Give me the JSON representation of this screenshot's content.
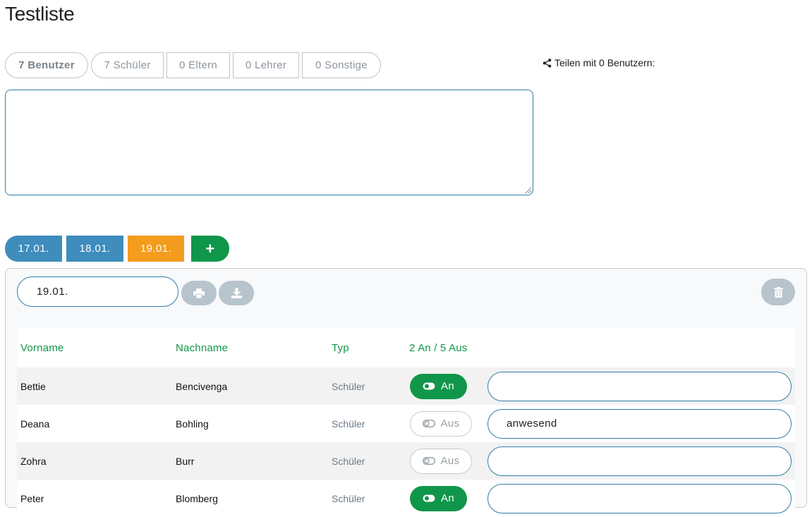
{
  "page": {
    "title": "Testliste"
  },
  "filters": [
    {
      "label": "7 Benutzer"
    },
    {
      "label": "7 Schüler"
    },
    {
      "label": "0 Eltern"
    },
    {
      "label": "0 Lehrer"
    },
    {
      "label": "0 Sonstige"
    }
  ],
  "share": {
    "label": "Teilen mit 0 Benutzern:"
  },
  "notes": {
    "value": ""
  },
  "date_tabs": [
    {
      "label": "17.01."
    },
    {
      "label": "18.01."
    },
    {
      "label": "19.01."
    },
    {
      "label": "+"
    }
  ],
  "panel": {
    "date_value": "19.01.",
    "table": {
      "headers": {
        "first_name": "Vorname",
        "last_name": "Nachname",
        "type": "Typ",
        "status": "2 An / 5 Aus"
      },
      "rows": [
        {
          "first_name": "Bettie",
          "last_name": "Bencivenga",
          "type": "Schüler",
          "status": "An",
          "comment": ""
        },
        {
          "first_name": "Deana",
          "last_name": "Bohling",
          "type": "Schüler",
          "status": "Aus",
          "comment": "anwesend"
        },
        {
          "first_name": "Zohra",
          "last_name": "Burr",
          "type": "Schüler",
          "status": "Aus",
          "comment": ""
        },
        {
          "first_name": "Peter",
          "last_name": "Blomberg",
          "type": "Schüler",
          "status": "An",
          "comment": ""
        }
      ]
    }
  },
  "colors": {
    "primary": "#3e8dbd",
    "active_tab": "#f39c1e",
    "success": "#10964a",
    "muted_button": "#b8c4cc"
  },
  "icons": {
    "share": "share-icon",
    "print": "print-icon",
    "download": "download-icon",
    "trash": "trash-icon",
    "toggle": "toggle-icon"
  }
}
